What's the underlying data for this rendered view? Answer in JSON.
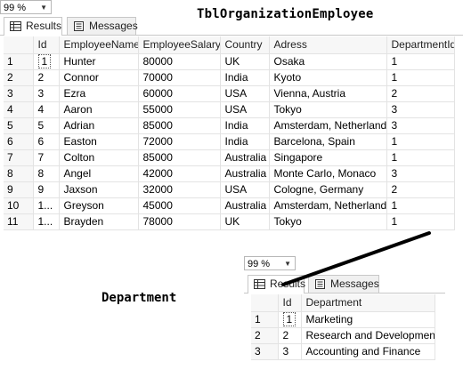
{
  "top": {
    "zoom": "99 %",
    "tabs": [
      {
        "label": "Results"
      },
      {
        "label": "Messages"
      }
    ],
    "table_title": "TblOrganizationEmployee",
    "columns": [
      "Id",
      "EmployeeName",
      "EmployeeSalary",
      "Country",
      "Adress",
      "DepartmentId"
    ],
    "rows": [
      {
        "n": "1",
        "id": "1",
        "name": "Hunter",
        "salary": "80000",
        "country": "UK",
        "address": "Osaka",
        "dept": "1"
      },
      {
        "n": "2",
        "id": "2",
        "name": "Connor",
        "salary": "70000",
        "country": "India",
        "address": "Kyoto",
        "dept": "1"
      },
      {
        "n": "3",
        "id": "3",
        "name": "Ezra",
        "salary": "60000",
        "country": "USA",
        "address": "Vienna, Austria",
        "dept": "2"
      },
      {
        "n": "4",
        "id": "4",
        "name": "Aaron",
        "salary": "55000",
        "country": "USA",
        "address": "Tokyo",
        "dept": "3"
      },
      {
        "n": "5",
        "id": "5",
        "name": "Adrian",
        "salary": "85000",
        "country": "India",
        "address": "Amsterdam, Netherlands",
        "dept": "3"
      },
      {
        "n": "6",
        "id": "6",
        "name": "Easton",
        "salary": "72000",
        "country": "India",
        "address": "Barcelona, Spain",
        "dept": "1"
      },
      {
        "n": "7",
        "id": "7",
        "name": "Colton",
        "salary": "85000",
        "country": "Australia",
        "address": "Singapore",
        "dept": "1"
      },
      {
        "n": "8",
        "id": "8",
        "name": "Angel",
        "salary": "42000",
        "country": "Australia",
        "address": "Monte Carlo, Monaco",
        "dept": "3"
      },
      {
        "n": "9",
        "id": "9",
        "name": "Jaxson",
        "salary": "32000",
        "country": "USA",
        "address": "Cologne, Germany",
        "dept": "2"
      },
      {
        "n": "10",
        "id": "1...",
        "name": "Greyson",
        "salary": "45000",
        "country": "Australia",
        "address": "Amsterdam, Netherlands",
        "dept": "1"
      },
      {
        "n": "11",
        "id": "1...",
        "name": "Brayden",
        "salary": "78000",
        "country": "UK",
        "address": "Tokyo",
        "dept": "1"
      }
    ]
  },
  "bottom": {
    "zoom": "99 %",
    "tabs": [
      {
        "label": "Results"
      },
      {
        "label": "Messages"
      }
    ],
    "table_title": "Department",
    "columns": [
      "Id",
      "Department"
    ],
    "rows": [
      {
        "n": "1",
        "id": "1",
        "name": "Marketing"
      },
      {
        "n": "2",
        "id": "2",
        "name": "Research and Development"
      },
      {
        "n": "3",
        "id": "3",
        "name": "Accounting and Finance"
      }
    ]
  },
  "colors": {
    "accent_line": "#000000",
    "grid_border": "#e3e3e3",
    "header_bg": "#f7f7f7"
  },
  "icons": [
    "grid-icon",
    "messages-icon",
    "dropdown-caret-icon"
  ]
}
